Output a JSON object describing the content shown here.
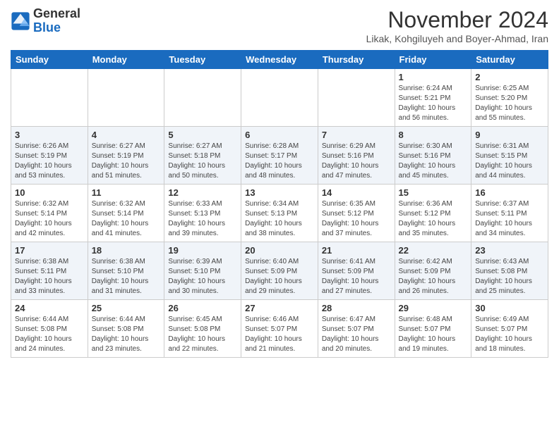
{
  "header": {
    "logo_line1": "General",
    "logo_line2": "Blue",
    "month_title": "November 2024",
    "location": "Likak, Kohgiluyeh and Boyer-Ahmad, Iran"
  },
  "weekdays": [
    "Sunday",
    "Monday",
    "Tuesday",
    "Wednesday",
    "Thursday",
    "Friday",
    "Saturday"
  ],
  "weeks": [
    [
      {
        "day": "",
        "info": ""
      },
      {
        "day": "",
        "info": ""
      },
      {
        "day": "",
        "info": ""
      },
      {
        "day": "",
        "info": ""
      },
      {
        "day": "",
        "info": ""
      },
      {
        "day": "1",
        "info": "Sunrise: 6:24 AM\nSunset: 5:21 PM\nDaylight: 10 hours\nand 56 minutes."
      },
      {
        "day": "2",
        "info": "Sunrise: 6:25 AM\nSunset: 5:20 PM\nDaylight: 10 hours\nand 55 minutes."
      }
    ],
    [
      {
        "day": "3",
        "info": "Sunrise: 6:26 AM\nSunset: 5:19 PM\nDaylight: 10 hours\nand 53 minutes."
      },
      {
        "day": "4",
        "info": "Sunrise: 6:27 AM\nSunset: 5:19 PM\nDaylight: 10 hours\nand 51 minutes."
      },
      {
        "day": "5",
        "info": "Sunrise: 6:27 AM\nSunset: 5:18 PM\nDaylight: 10 hours\nand 50 minutes."
      },
      {
        "day": "6",
        "info": "Sunrise: 6:28 AM\nSunset: 5:17 PM\nDaylight: 10 hours\nand 48 minutes."
      },
      {
        "day": "7",
        "info": "Sunrise: 6:29 AM\nSunset: 5:16 PM\nDaylight: 10 hours\nand 47 minutes."
      },
      {
        "day": "8",
        "info": "Sunrise: 6:30 AM\nSunset: 5:16 PM\nDaylight: 10 hours\nand 45 minutes."
      },
      {
        "day": "9",
        "info": "Sunrise: 6:31 AM\nSunset: 5:15 PM\nDaylight: 10 hours\nand 44 minutes."
      }
    ],
    [
      {
        "day": "10",
        "info": "Sunrise: 6:32 AM\nSunset: 5:14 PM\nDaylight: 10 hours\nand 42 minutes."
      },
      {
        "day": "11",
        "info": "Sunrise: 6:32 AM\nSunset: 5:14 PM\nDaylight: 10 hours\nand 41 minutes."
      },
      {
        "day": "12",
        "info": "Sunrise: 6:33 AM\nSunset: 5:13 PM\nDaylight: 10 hours\nand 39 minutes."
      },
      {
        "day": "13",
        "info": "Sunrise: 6:34 AM\nSunset: 5:13 PM\nDaylight: 10 hours\nand 38 minutes."
      },
      {
        "day": "14",
        "info": "Sunrise: 6:35 AM\nSunset: 5:12 PM\nDaylight: 10 hours\nand 37 minutes."
      },
      {
        "day": "15",
        "info": "Sunrise: 6:36 AM\nSunset: 5:12 PM\nDaylight: 10 hours\nand 35 minutes."
      },
      {
        "day": "16",
        "info": "Sunrise: 6:37 AM\nSunset: 5:11 PM\nDaylight: 10 hours\nand 34 minutes."
      }
    ],
    [
      {
        "day": "17",
        "info": "Sunrise: 6:38 AM\nSunset: 5:11 PM\nDaylight: 10 hours\nand 33 minutes."
      },
      {
        "day": "18",
        "info": "Sunrise: 6:38 AM\nSunset: 5:10 PM\nDaylight: 10 hours\nand 31 minutes."
      },
      {
        "day": "19",
        "info": "Sunrise: 6:39 AM\nSunset: 5:10 PM\nDaylight: 10 hours\nand 30 minutes."
      },
      {
        "day": "20",
        "info": "Sunrise: 6:40 AM\nSunset: 5:09 PM\nDaylight: 10 hours\nand 29 minutes."
      },
      {
        "day": "21",
        "info": "Sunrise: 6:41 AM\nSunset: 5:09 PM\nDaylight: 10 hours\nand 27 minutes."
      },
      {
        "day": "22",
        "info": "Sunrise: 6:42 AM\nSunset: 5:09 PM\nDaylight: 10 hours\nand 26 minutes."
      },
      {
        "day": "23",
        "info": "Sunrise: 6:43 AM\nSunset: 5:08 PM\nDaylight: 10 hours\nand 25 minutes."
      }
    ],
    [
      {
        "day": "24",
        "info": "Sunrise: 6:44 AM\nSunset: 5:08 PM\nDaylight: 10 hours\nand 24 minutes."
      },
      {
        "day": "25",
        "info": "Sunrise: 6:44 AM\nSunset: 5:08 PM\nDaylight: 10 hours\nand 23 minutes."
      },
      {
        "day": "26",
        "info": "Sunrise: 6:45 AM\nSunset: 5:08 PM\nDaylight: 10 hours\nand 22 minutes."
      },
      {
        "day": "27",
        "info": "Sunrise: 6:46 AM\nSunset: 5:07 PM\nDaylight: 10 hours\nand 21 minutes."
      },
      {
        "day": "28",
        "info": "Sunrise: 6:47 AM\nSunset: 5:07 PM\nDaylight: 10 hours\nand 20 minutes."
      },
      {
        "day": "29",
        "info": "Sunrise: 6:48 AM\nSunset: 5:07 PM\nDaylight: 10 hours\nand 19 minutes."
      },
      {
        "day": "30",
        "info": "Sunrise: 6:49 AM\nSunset: 5:07 PM\nDaylight: 10 hours\nand 18 minutes."
      }
    ]
  ]
}
